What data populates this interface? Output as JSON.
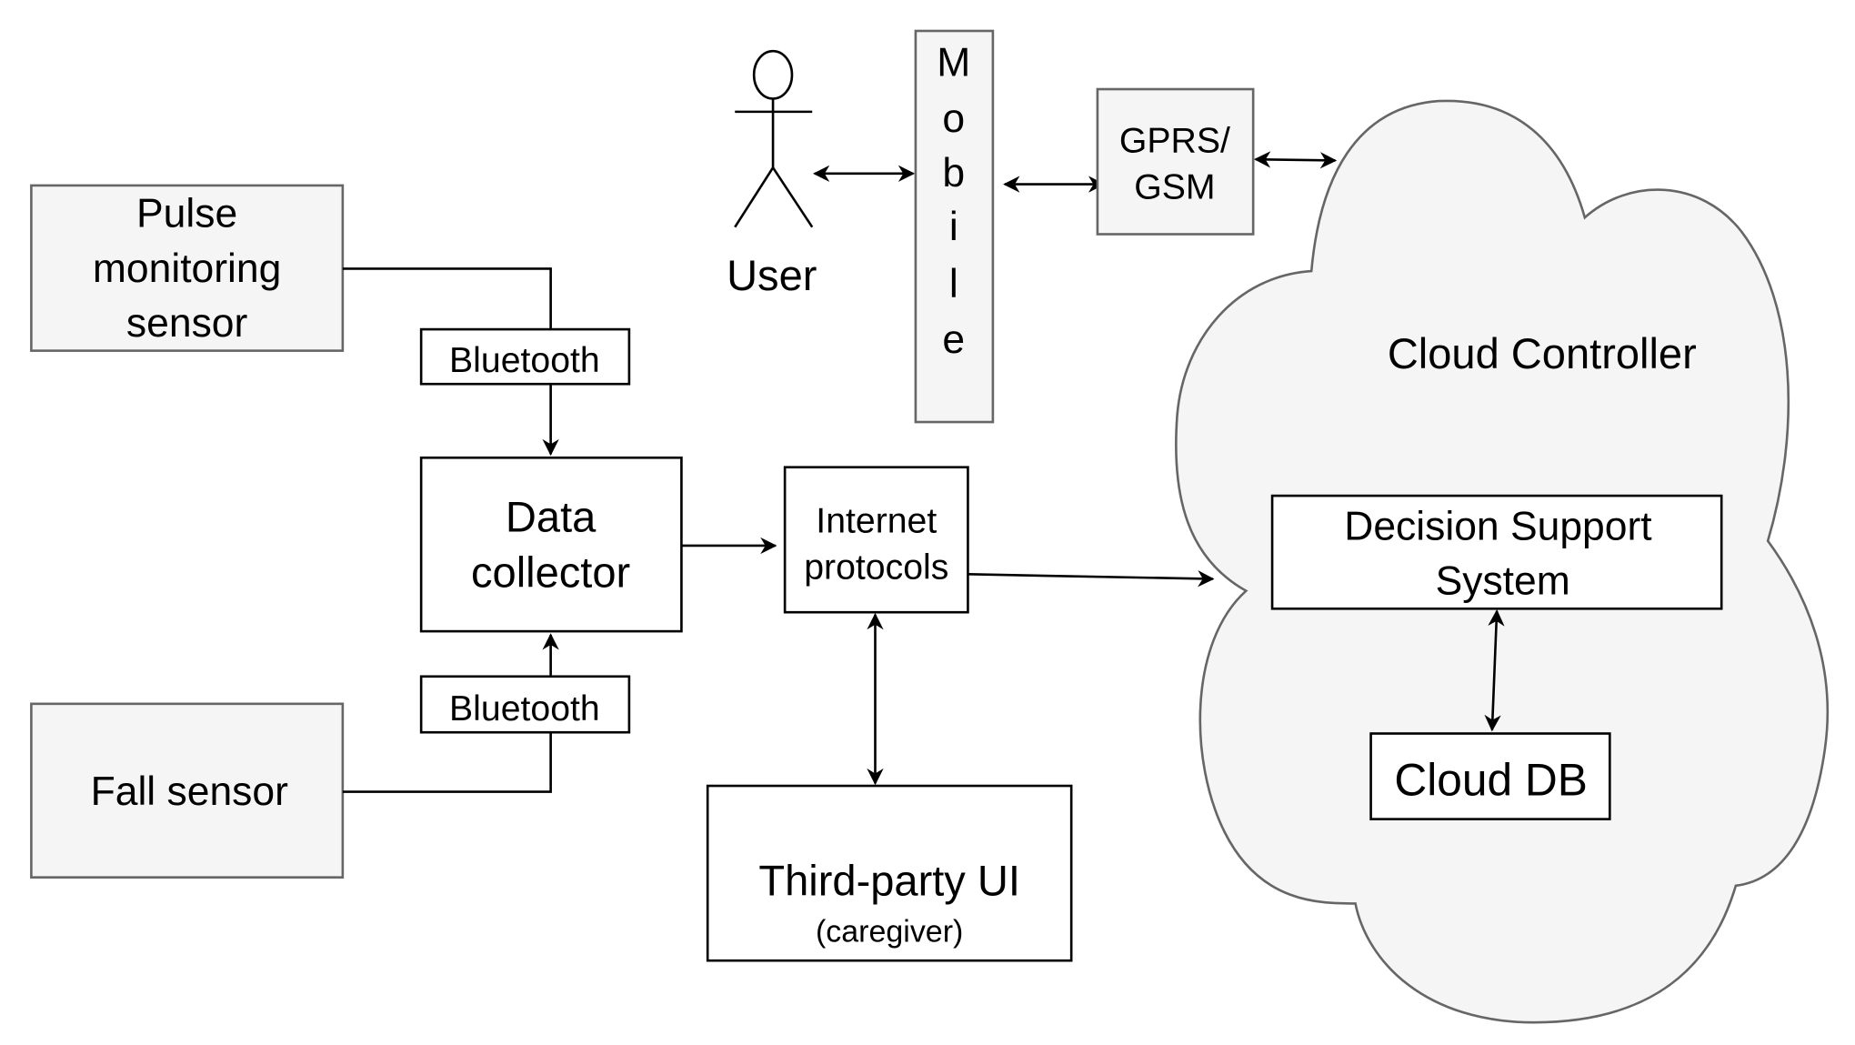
{
  "diagram": {
    "nodes": {
      "pulse_sensor": {
        "lines": [
          "Pulse",
          "monitoring",
          "sensor"
        ]
      },
      "fall_sensor": {
        "label": "Fall sensor"
      },
      "bluetooth_top": {
        "label": "Bluetooth"
      },
      "bluetooth_bottom": {
        "label": "Bluetooth"
      },
      "data_collector": {
        "lines": [
          "Data",
          "collector"
        ]
      },
      "internet_protocols": {
        "lines": [
          "Internet",
          "protocols"
        ]
      },
      "third_party_ui": {
        "label": "Third-party UI",
        "sublabel": "(caregiver)"
      },
      "user": {
        "label": "User"
      },
      "mobile": {
        "letters": [
          "M",
          "o",
          "b",
          "i",
          "l",
          "e"
        ]
      },
      "gprs_gsm": {
        "lines": [
          "GPRS/",
          "GSM"
        ]
      },
      "cloud_controller": {
        "label": "Cloud Controller"
      },
      "decision_support": {
        "lines": [
          "Decision Support",
          "System"
        ]
      },
      "cloud_db": {
        "label": "Cloud DB"
      }
    },
    "edges": [
      {
        "from": "pulse_sensor",
        "to": "data_collector",
        "via": "bluetooth_top",
        "direction": "one-way"
      },
      {
        "from": "fall_sensor",
        "to": "data_collector",
        "via": "bluetooth_bottom",
        "direction": "one-way"
      },
      {
        "from": "data_collector",
        "to": "internet_protocols",
        "direction": "one-way"
      },
      {
        "from": "internet_protocols",
        "to": "cloud_controller",
        "direction": "one-way"
      },
      {
        "from": "internet_protocols",
        "to": "third_party_ui",
        "direction": "two-way"
      },
      {
        "from": "user",
        "to": "mobile",
        "direction": "two-way"
      },
      {
        "from": "mobile",
        "to": "gprs_gsm",
        "direction": "two-way"
      },
      {
        "from": "gprs_gsm",
        "to": "cloud_controller",
        "direction": "two-way"
      },
      {
        "from": "decision_support",
        "to": "cloud_db",
        "direction": "two-way"
      }
    ],
    "colors": {
      "gray_fill": "#f5f5f5",
      "gray_stroke": "#666666",
      "line": "#000000"
    }
  }
}
